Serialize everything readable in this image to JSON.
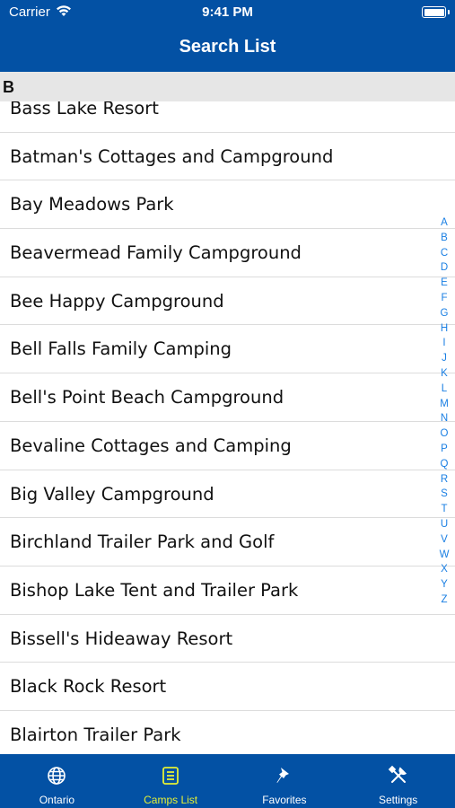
{
  "status": {
    "carrier": "Carrier",
    "time": "9:41 PM"
  },
  "nav": {
    "title": "Search List"
  },
  "section": {
    "letter": "B"
  },
  "items": [
    "Bass Lake Resort",
    "Batman's Cottages and Campground",
    "Bay Meadows Park",
    "Beavermead Family Campground",
    "Bee Happy Campground",
    "Bell Falls Family Camping",
    "Bell's Point Beach Campground",
    "Bevaline Cottages and Camping",
    "Big Valley Campground",
    "Birchland Trailer Park and Golf",
    "Bishop Lake Tent and Trailer Park",
    "Bissell's Hideaway Resort",
    "Black Rock Resort",
    "Blairton Trailer Park"
  ],
  "index_letters": [
    "A",
    "B",
    "C",
    "D",
    "E",
    "F",
    "G",
    "H",
    "I",
    "J",
    "K",
    "L",
    "M",
    "N",
    "O",
    "P",
    "Q",
    "R",
    "S",
    "T",
    "U",
    "V",
    "W",
    "X",
    "Y",
    "Z"
  ],
  "tabs": [
    {
      "label": "Ontario",
      "icon": "globe-icon",
      "active": false
    },
    {
      "label": "Camps List",
      "icon": "list-icon",
      "active": true
    },
    {
      "label": "Favorites",
      "icon": "pin-icon",
      "active": false
    },
    {
      "label": "Settings",
      "icon": "tools-icon",
      "active": false
    }
  ],
  "colors": {
    "bar": "#0351a4",
    "active_tab": "#e5ef35",
    "index": "#1a7fe3",
    "section_bg": "#e6e6e6"
  }
}
